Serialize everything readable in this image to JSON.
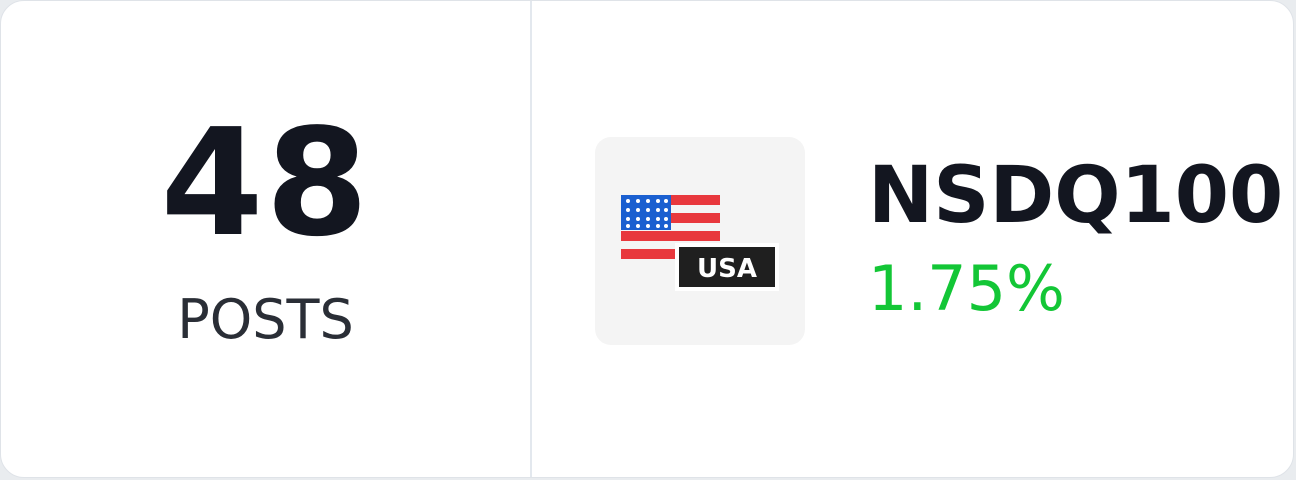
{
  "stats": {
    "count": "48",
    "label": "POSTS"
  },
  "instrument": {
    "symbol": "NSDQ100",
    "change": "1.75%",
    "icon": "usa-flag-icon",
    "icon_badge": "USA"
  },
  "colors": {
    "positive": "#13c636",
    "text_primary": "#131620",
    "flag_red": "#e8383d",
    "flag_blue": "#1a5fd0",
    "badge_bg": "#1f1f1f"
  }
}
